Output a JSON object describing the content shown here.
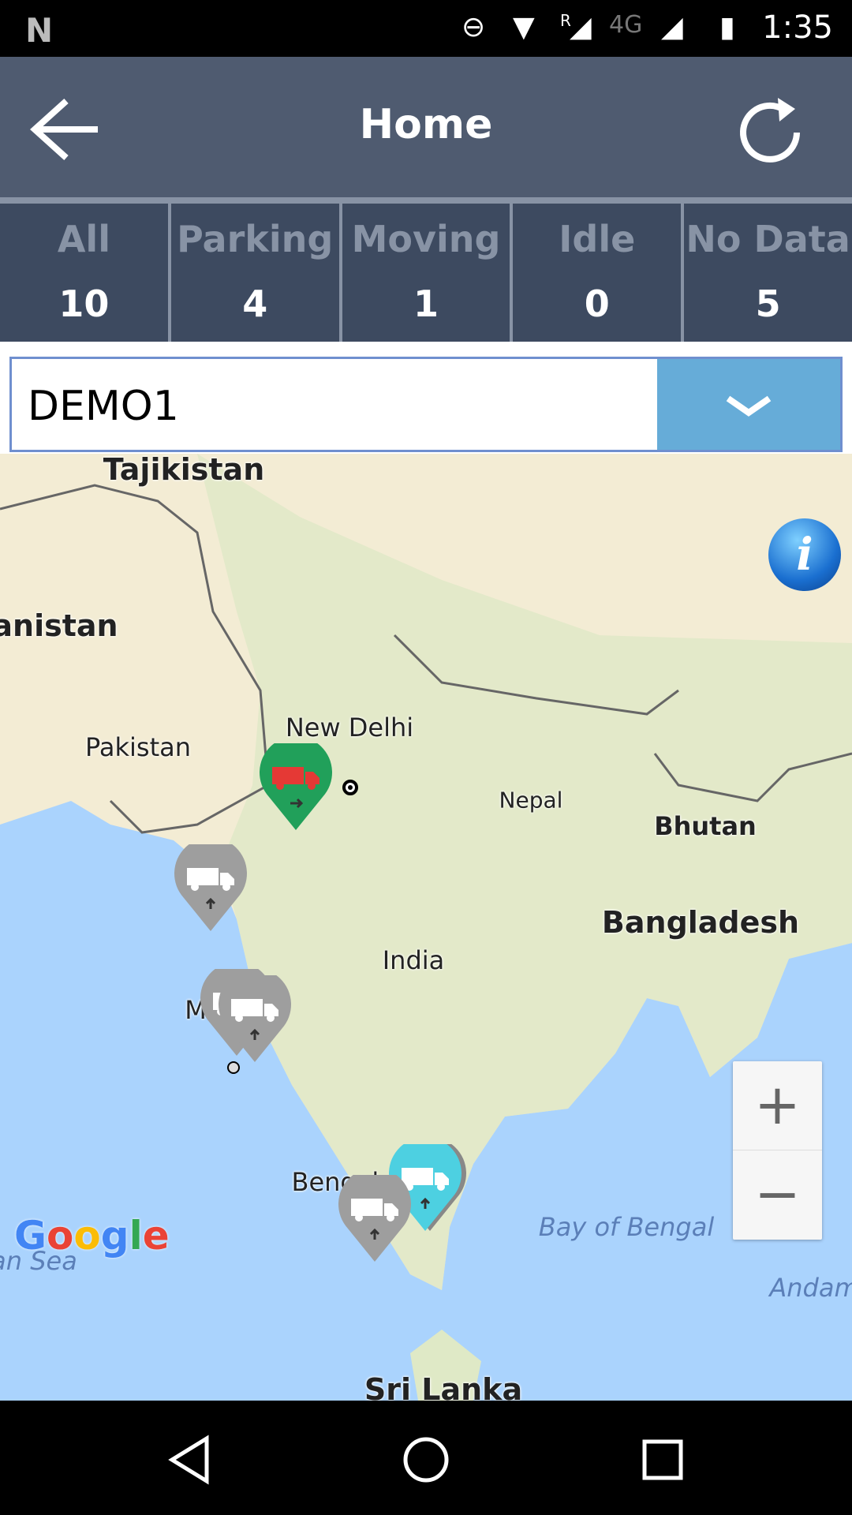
{
  "status_bar": {
    "time": "1:35",
    "network": "4G",
    "roaming": "R"
  },
  "header": {
    "title": "Home",
    "back_icon": "arrow-left-icon",
    "refresh_icon": "refresh-icon"
  },
  "tabs": [
    {
      "label": "All",
      "count": "10"
    },
    {
      "label": "Parking",
      "count": "4"
    },
    {
      "label": "Moving",
      "count": "1"
    },
    {
      "label": "Idle",
      "count": "0"
    },
    {
      "label": "No Data",
      "count": "5"
    }
  ],
  "selector": {
    "value": "DEMO1"
  },
  "map": {
    "labels": {
      "tajikistan": "Tajikistan",
      "afghanistan": "anistan",
      "pakistan": "Pakistan",
      "new_delhi": "New Delhi",
      "nepal": "Nepal",
      "bhutan": "Bhutan",
      "bangladesh": "Bangladesh",
      "india": "India",
      "mumbai": "M",
      "bengaluru": "Bengalu",
      "bay_of_bengal": "Bay of Bengal",
      "andaman": "Andam",
      "arabian_sea": "an Sea",
      "sri_lanka": "Sri Lanka"
    },
    "zoom_in": "+",
    "zoom_out": "−",
    "google_logo": "Google",
    "info": "i",
    "colors": {
      "moving": "#21a05a",
      "no_data": "#9e9e9e",
      "parking": "#4dd0e1",
      "ocean": "#aad3fd",
      "land": "#f3ecd4"
    }
  }
}
